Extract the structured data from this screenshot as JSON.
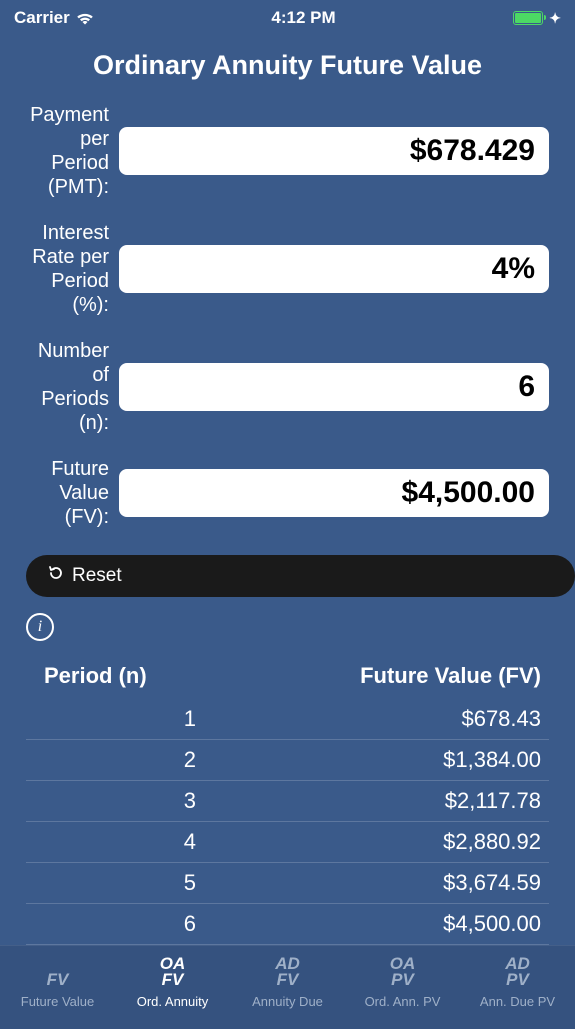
{
  "status": {
    "carrier": "Carrier",
    "time": "4:12 PM"
  },
  "title": "Ordinary Annuity Future Value",
  "form": {
    "pmt": {
      "label": "Payment per Period (PMT):",
      "value": "$678.429"
    },
    "rate": {
      "label": "Interest Rate per Period (%):",
      "value": "4%"
    },
    "n": {
      "label": "Number of Periods (n):",
      "value": "6"
    },
    "fv": {
      "label": "Future Value (FV):",
      "value": "$4,500.00"
    }
  },
  "reset_label": "Reset",
  "table": {
    "headers": {
      "period": "Period (n)",
      "value": "Future Value (FV)"
    },
    "rows": [
      {
        "period": "1",
        "value": "$678.43"
      },
      {
        "period": "2",
        "value": "$1,384.00"
      },
      {
        "period": "3",
        "value": "$2,117.78"
      },
      {
        "period": "4",
        "value": "$2,880.92"
      },
      {
        "period": "5",
        "value": "$3,674.59"
      },
      {
        "period": "6",
        "value": "$4,500.00"
      }
    ]
  },
  "tabs": [
    {
      "icon": "FV",
      "label": "Future Value"
    },
    {
      "icon": "OA\nFV",
      "label": "Ord. Annuity"
    },
    {
      "icon": "AD\nFV",
      "label": "Annuity Due"
    },
    {
      "icon": "OA\nPV",
      "label": "Ord. Ann. PV"
    },
    {
      "icon": "AD\nPV",
      "label": "Ann. Due PV"
    }
  ]
}
